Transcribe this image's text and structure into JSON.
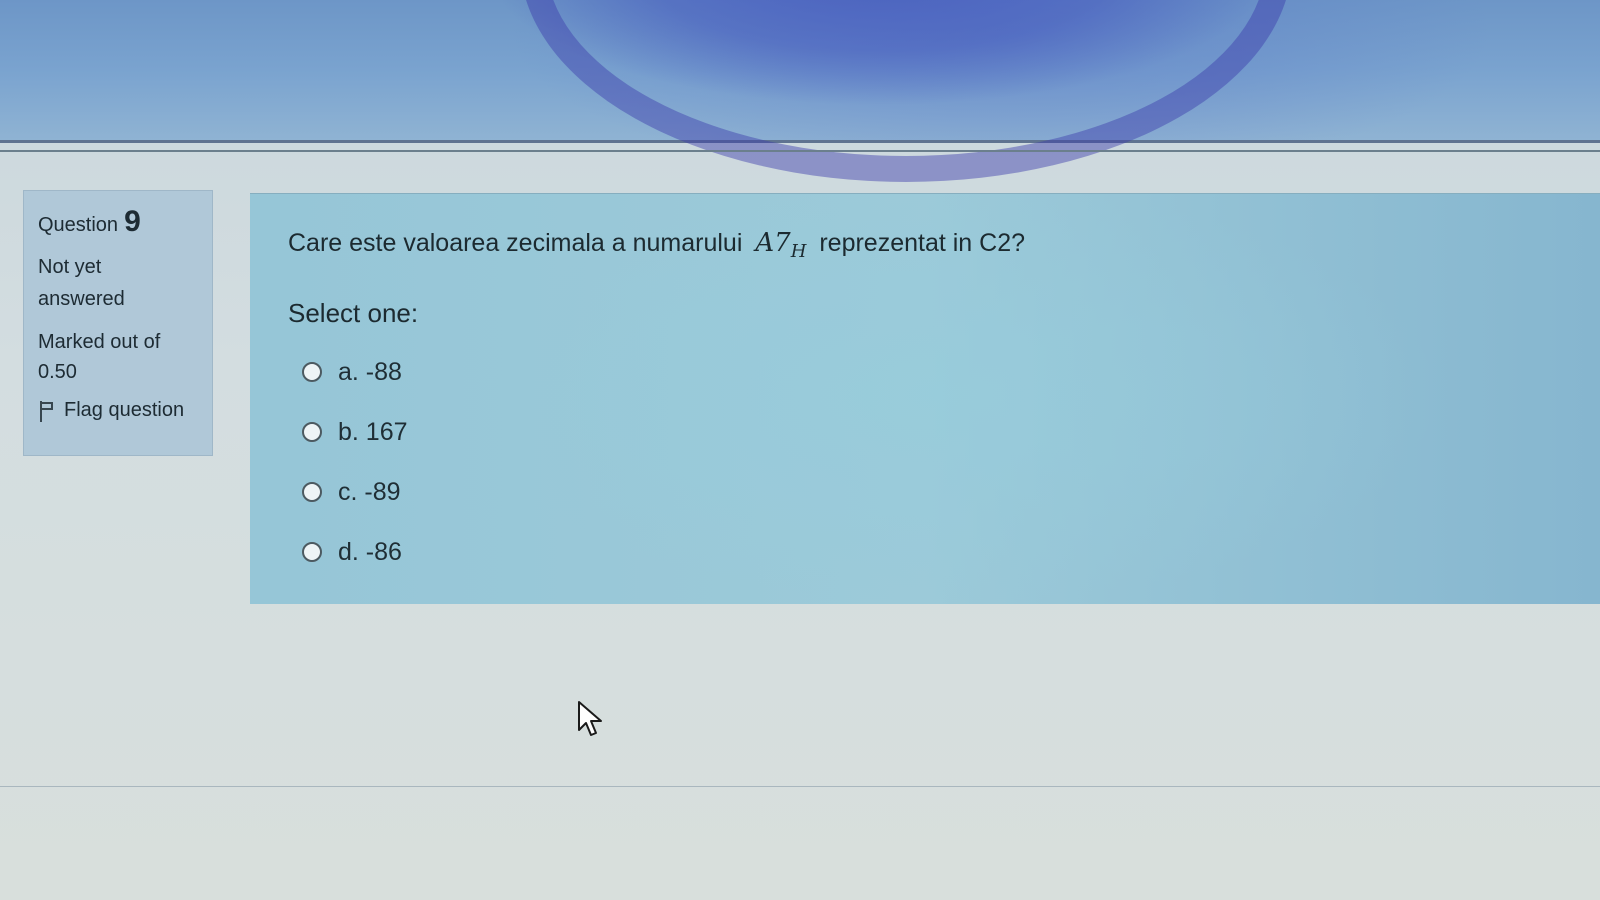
{
  "question_info": {
    "label": "Question",
    "number": "9",
    "state_line1": "Not yet",
    "state_line2": "answered",
    "grade_line1": "Marked out of",
    "grade_line2": "0.50",
    "flag_label": "Flag question",
    "flag_icon": "flag-icon"
  },
  "question": {
    "text_before": "Care este valoarea zecimala a numarului",
    "math_main": "A7",
    "math_sub": "H",
    "text_after": "reprezentat in C2?",
    "select_label": "Select one:",
    "options": [
      {
        "label": "a. -88"
      },
      {
        "label": "b. 167"
      },
      {
        "label": "c. -89"
      },
      {
        "label": "d. -86"
      }
    ]
  },
  "colors": {
    "info_panel": "#b0c8d8",
    "content_panel": "#96c6d7",
    "header": "#6d96c7"
  }
}
